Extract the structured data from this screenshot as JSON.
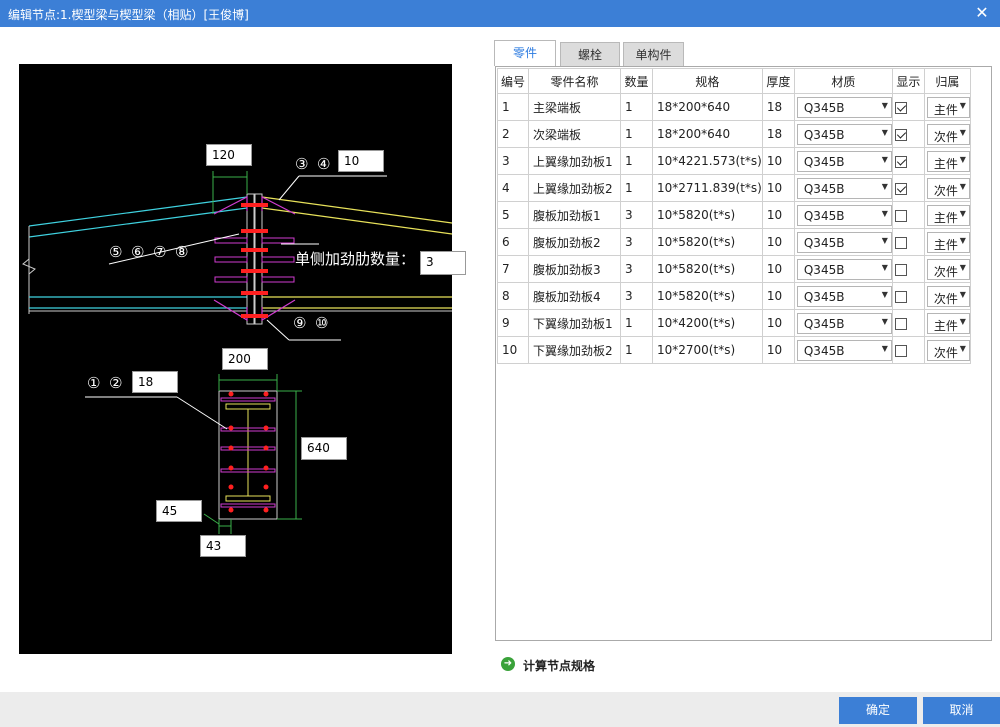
{
  "window": {
    "title": "编辑节点:1.楔型梁与楔型梁（相贴）[王俊博]",
    "close_glyph": "✕"
  },
  "drawing": {
    "inputs": {
      "top_width": "120",
      "plate_no_34": "10",
      "stiffener_count": "3",
      "plate_no_12": "18",
      "width_200": "200",
      "height_640": "640",
      "offset_45": "45",
      "offset_43": "43"
    },
    "labels": {
      "c3": "③",
      "c4": "④",
      "c5": "⑤",
      "c6": "⑥",
      "c7": "⑦",
      "c8": "⑧",
      "c9": "⑨",
      "c10": "⑩",
      "c1": "①",
      "c2": "②",
      "stiffener_text": "单侧加劲肋数量："
    }
  },
  "tabs": [
    {
      "label": "零件"
    },
    {
      "label": "螺栓"
    },
    {
      "label": "单构件"
    }
  ],
  "table": {
    "headers": {
      "no": "编号",
      "name": "零件名称",
      "qty": "数量",
      "spec": "规格",
      "thk": "厚度",
      "mat": "材质",
      "show": "显示",
      "owner": "归属"
    },
    "rows": [
      {
        "no": "1",
        "name": "主梁端板",
        "qty": "1",
        "spec": "18*200*640",
        "thk": "18",
        "mat": "Q345B",
        "show": true,
        "owner": "主件"
      },
      {
        "no": "2",
        "name": "次梁端板",
        "qty": "1",
        "spec": "18*200*640",
        "thk": "18",
        "mat": "Q345B",
        "show": true,
        "owner": "次件"
      },
      {
        "no": "3",
        "name": "上翼缘加劲板1",
        "qty": "1",
        "spec": "10*4221.573(t*s)",
        "thk": "10",
        "mat": "Q345B",
        "show": true,
        "owner": "主件"
      },
      {
        "no": "4",
        "name": "上翼缘加劲板2",
        "qty": "1",
        "spec": "10*2711.839(t*s)",
        "thk": "10",
        "mat": "Q345B",
        "show": true,
        "owner": "次件"
      },
      {
        "no": "5",
        "name": "腹板加劲板1",
        "qty": "3",
        "spec": "10*5820(t*s)",
        "thk": "10",
        "mat": "Q345B",
        "show": false,
        "owner": "主件"
      },
      {
        "no": "6",
        "name": "腹板加劲板2",
        "qty": "3",
        "spec": "10*5820(t*s)",
        "thk": "10",
        "mat": "Q345B",
        "show": false,
        "owner": "主件"
      },
      {
        "no": "7",
        "name": "腹板加劲板3",
        "qty": "3",
        "spec": "10*5820(t*s)",
        "thk": "10",
        "mat": "Q345B",
        "show": false,
        "owner": "次件"
      },
      {
        "no": "8",
        "name": "腹板加劲板4",
        "qty": "3",
        "spec": "10*5820(t*s)",
        "thk": "10",
        "mat": "Q345B",
        "show": false,
        "owner": "次件"
      },
      {
        "no": "9",
        "name": "下翼缘加劲板1",
        "qty": "1",
        "spec": "10*4200(t*s)",
        "thk": "10",
        "mat": "Q345B",
        "show": false,
        "owner": "主件"
      },
      {
        "no": "10",
        "name": "下翼缘加劲板2",
        "qty": "1",
        "spec": "10*2700(t*s)",
        "thk": "10",
        "mat": "Q345B",
        "show": false,
        "owner": "次件"
      }
    ]
  },
  "calc": {
    "label": "计算节点规格",
    "icon": "arrow-right-circle-icon"
  },
  "buttons": {
    "ok": "确定",
    "cancel": "取消"
  },
  "colors": {
    "accent": "#3c7fd6",
    "drawing_bg": "#000000",
    "cyan": "#3fd2e0",
    "yellow": "#e8e25a",
    "magenta": "#d03cd0",
    "red": "#ff2020"
  }
}
